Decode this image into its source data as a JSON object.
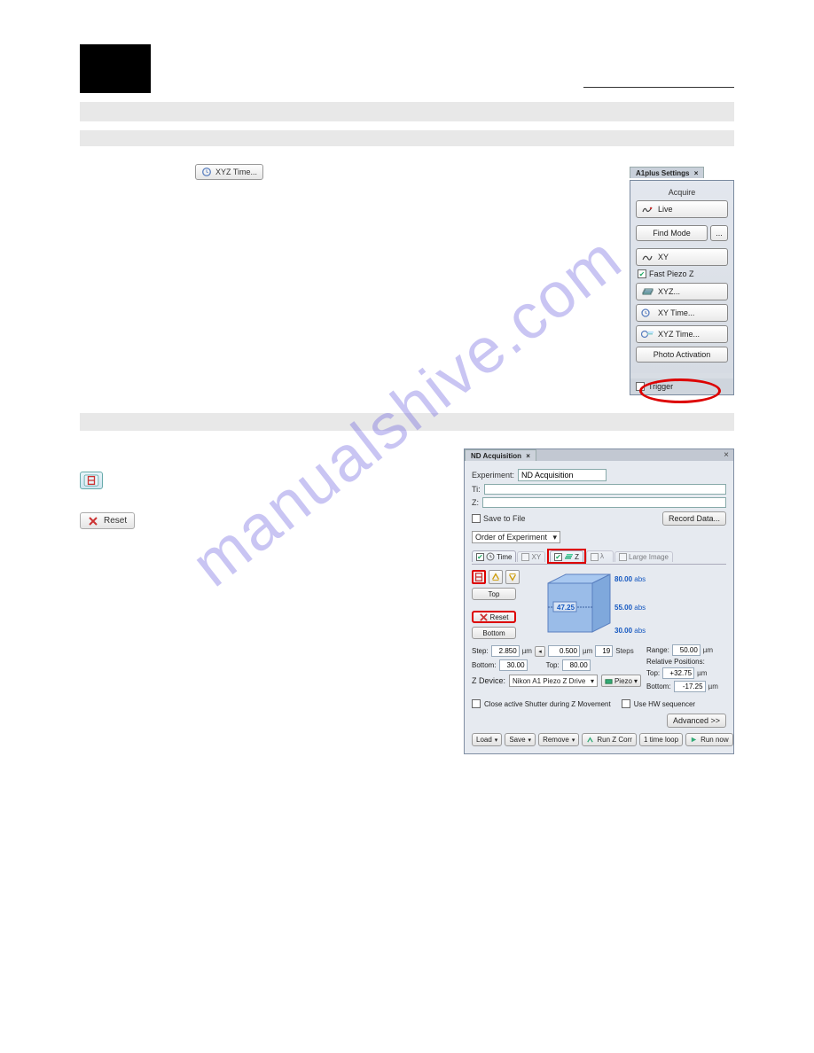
{
  "watermark": "manualshive.com",
  "top_button": {
    "label": "XYZ Time..."
  },
  "a1panel": {
    "tab": "A1plus Settings",
    "acquire": "Acquire",
    "live": "Live",
    "find_mode": "Find Mode",
    "dots": "...",
    "xy": "XY",
    "fast_piezo": "Fast Piezo Z",
    "xyz": "XYZ...",
    "xy_time": "XY Time...",
    "xyz_time": "XYZ Time...",
    "photo_activation": "Photo Activation",
    "trigger": "Trigger"
  },
  "nd": {
    "tab": "ND Acquisition",
    "experiment_label": "Experiment:",
    "experiment_value": "ND Acquisition",
    "ti_label": "Ti:",
    "z_path_label": "Z:",
    "save_to_file": "Save to File",
    "record_data": "Record Data...",
    "order_label": "Order of Experiment",
    "tabs": {
      "time": "Time",
      "xy": "XY",
      "z": "Z",
      "large": "Large Image"
    },
    "top_btn": "Top",
    "reset_btn": "Reset",
    "bottom_btn": "Bottom",
    "cube": {
      "top_val": "80.00",
      "top_abs": "abs",
      "mid_left": "47.25",
      "mid_right": "55.00",
      "mid_abs": "abs",
      "bot_val": "30.00",
      "bot_abs": "abs"
    },
    "step_label": "Step:",
    "step_val": "2.850",
    "step_unit": "µm",
    "step_size_val": "0.500",
    "step_size_unit": "µm",
    "steps_val": "19",
    "steps_unit": "Steps",
    "bottom_label": "Bottom:",
    "bottom_val": "30.00",
    "top_label": "Top:",
    "top_val": "80.00",
    "range_label": "Range:",
    "range_val": "50.00",
    "range_unit": "µm",
    "relpos_label": "Relative Positions:",
    "rel_top_label": "Top:",
    "rel_top_val": "+32.75",
    "rel_bot_label": "Bottom:",
    "rel_bot_val": "-17.25",
    "rel_unit": "µm",
    "zdev_label": "Z Device:",
    "zdev_val": "Nikon A1 Piezo Z Drive",
    "piezo_btn": "Piezo",
    "close_shutter": "Close active Shutter during Z Movement",
    "use_hw": "Use HW sequencer",
    "advanced": "Advanced >>",
    "load": "Load",
    "save": "Save",
    "remove": "Remove",
    "runz": "Run Z Corr",
    "oneloop": "1 time loop",
    "runnow": "Run now"
  }
}
